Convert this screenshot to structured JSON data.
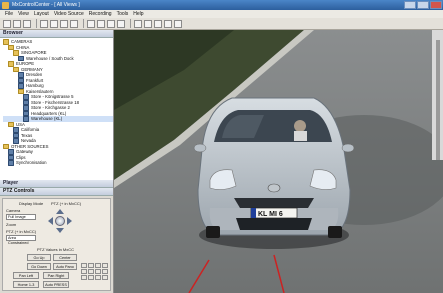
{
  "window": {
    "title": "MxControlCenter - [ All Views ]"
  },
  "menu": [
    "File",
    "View",
    "Layout",
    "Video Source",
    "Recording",
    "Tools",
    "Help"
  ],
  "toolbar_icons": [
    "open-icon",
    "save-icon",
    "print-icon",
    "layout-icon",
    "grid-icon",
    "camera-icon",
    "record-icon",
    "play-icon",
    "zoom-icon",
    "pan-icon",
    "speaker-icon",
    "mic-icon",
    "alarm-icon",
    "settings-icon",
    "key-icon",
    "help-icon"
  ],
  "browser": {
    "header": "Browser",
    "tree": [
      {
        "label": "CAMERAS",
        "level": 0,
        "icon": "folder"
      },
      {
        "label": "CHINA",
        "level": 1,
        "icon": "folder"
      },
      {
        "label": "SINGAPORE",
        "level": 2,
        "icon": "folder"
      },
      {
        "label": "Warehouse / South Dock",
        "level": 3,
        "icon": "cam"
      },
      {
        "label": "EUROPE",
        "level": 1,
        "icon": "folder"
      },
      {
        "label": "GERMANY",
        "level": 2,
        "icon": "folder"
      },
      {
        "label": "Dresden",
        "level": 3,
        "icon": "cam"
      },
      {
        "label": "Frankfurt",
        "level": 3,
        "icon": "cam"
      },
      {
        "label": "Hamburg",
        "level": 3,
        "icon": "cam"
      },
      {
        "label": "Kaiserslautern",
        "level": 3,
        "icon": "folder"
      },
      {
        "label": "Store - Königstrasse 5",
        "level": 4,
        "icon": "cam"
      },
      {
        "label": "Store - Fischerstrasse 18",
        "level": 4,
        "icon": "cam"
      },
      {
        "label": "Store - Kirchgasse 2",
        "level": 4,
        "icon": "cam"
      },
      {
        "label": "Headquarters (KL)",
        "level": 4,
        "icon": "cam"
      },
      {
        "label": "Warehouse (KL)",
        "level": 4,
        "icon": "cam",
        "selected": true
      },
      {
        "label": "USA",
        "level": 1,
        "icon": "folder"
      },
      {
        "label": "California",
        "level": 2,
        "icon": "cam"
      },
      {
        "label": "Texas",
        "level": 2,
        "icon": "cam"
      },
      {
        "label": "Nevada",
        "level": 2,
        "icon": "cam"
      },
      {
        "label": "OTHER SOURCES",
        "level": 0,
        "icon": "folder"
      },
      {
        "label": "Gateway",
        "level": 1,
        "icon": "cam"
      },
      {
        "label": "Clips",
        "level": 1,
        "icon": "cam"
      },
      {
        "label": "Synchronisation",
        "level": 1,
        "icon": "cam"
      }
    ]
  },
  "player": {
    "header": "Player",
    "ptz_header": "PTZ Controls",
    "display_mode_label": "Display Mode",
    "display_mode_value": "Full Image",
    "camera_label": "Camera",
    "zoom_label": "Zoom",
    "ptz_pad_label": "PTZ (+ in MxCC)",
    "ptz_value_label": "Area Constrained",
    "ptz_values_label": "PTZ Values in MxCC",
    "buttons": [
      "Go Up",
      "Center",
      "Go Down",
      "Auto Pano",
      "Pan Left",
      "Pan Right",
      "Home 1-3",
      "Auto PRESS"
    ]
  },
  "video": {
    "plate": "KL MI 6"
  }
}
